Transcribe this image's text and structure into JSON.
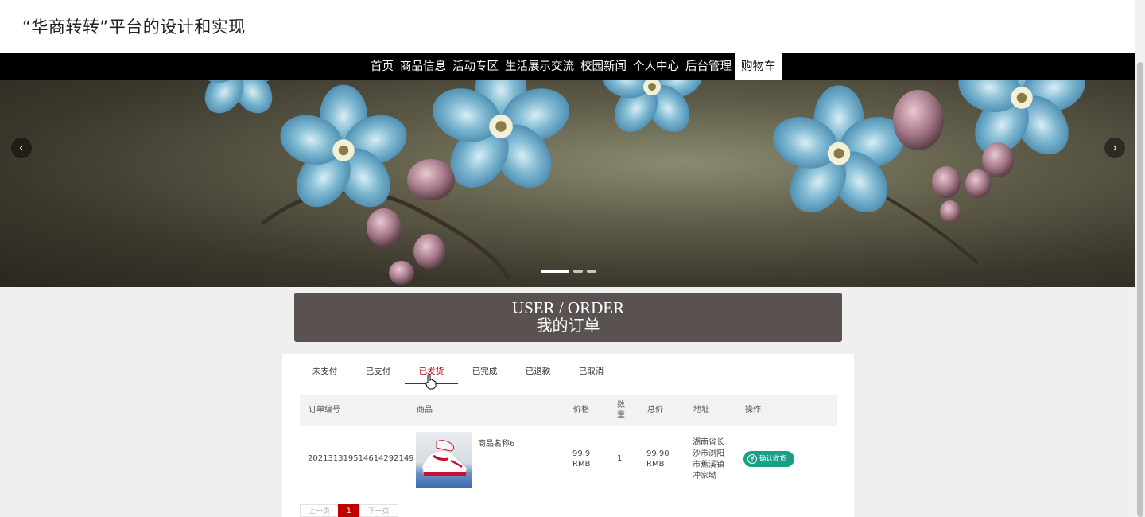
{
  "site": {
    "title": "“华商转转”平台的设计和实现"
  },
  "nav": {
    "items": [
      "首页",
      "商品信息",
      "活动专区",
      "生活展示交流",
      "校园新闻",
      "个人中心",
      "后台管理",
      "购物车"
    ],
    "active_index": 7
  },
  "banner": {
    "slide_count": 3,
    "active_slide": 0
  },
  "order_header": {
    "en": "USER / ORDER",
    "zh": "我的订单"
  },
  "tabs": {
    "items": [
      "未支付",
      "已支付",
      "已发货",
      "已完成",
      "已退款",
      "已取消"
    ],
    "active_index": 2
  },
  "table": {
    "headers": {
      "order_no": "订单编号",
      "product": "商品",
      "price": "价格",
      "qty": "数量",
      "total": "总价",
      "address": "地址",
      "action": "操作"
    },
    "rows": [
      {
        "order_no": "2021313195146142921​49",
        "product_name": "商品名称6",
        "price": "99.9 RMB",
        "qty": "1",
        "total": "99.90 RMB",
        "address": "湖南省长沙市浏阳市蕉溪镇冲家坳",
        "action_label": "确认收货"
      }
    ]
  },
  "pagination": {
    "prev": "上一页",
    "current": "1",
    "next": "下一页"
  },
  "colors": {
    "accent": "#c00000",
    "confirm": "#1aa086",
    "navbar": "#000000",
    "header_band": "#5a5250"
  }
}
